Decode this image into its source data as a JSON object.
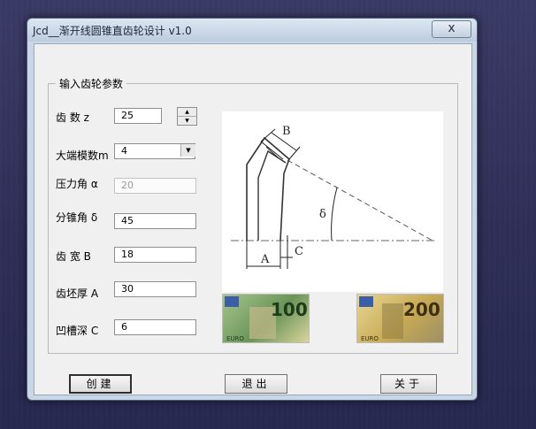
{
  "window": {
    "title": "Jcd__渐开线圆锥直齿轮设计 v1.0",
    "close_glyph": "x"
  },
  "group": {
    "legend": "输入齿轮参数",
    "fields": [
      {
        "label": "齿  数 z",
        "value": "25"
      },
      {
        "label": "大端模数m",
        "value": "4"
      },
      {
        "label": "压力角 α",
        "value": "20"
      },
      {
        "label": "分锥角 δ",
        "value": "45"
      },
      {
        "label": "齿  宽 B",
        "value": "18"
      },
      {
        "label": "齿坯厚 A",
        "value": "30"
      },
      {
        "label": "凹槽深 C",
        "value": "6"
      }
    ],
    "spinner": {
      "up_icon": "arrow-up-icon",
      "down_icon": "arrow-down-icon"
    },
    "dropdown": {
      "icon": "chevron-down-icon"
    }
  },
  "diagram": {
    "labels": {
      "b": "B",
      "delta": "δ",
      "a": "A",
      "c": "C"
    }
  },
  "banknotes": [
    {
      "value": "100",
      "text": "EURO"
    },
    {
      "value": "200",
      "text": "EURO"
    }
  ],
  "buttons": {
    "create": "创建",
    "exit": "退出",
    "about": "关于"
  },
  "colors": {
    "desktop": "#2e2e57",
    "window_frame": "#c8d6e6",
    "client": "#f0f0f0",
    "note100": "#7fa36a",
    "note200": "#d6bf5a"
  }
}
